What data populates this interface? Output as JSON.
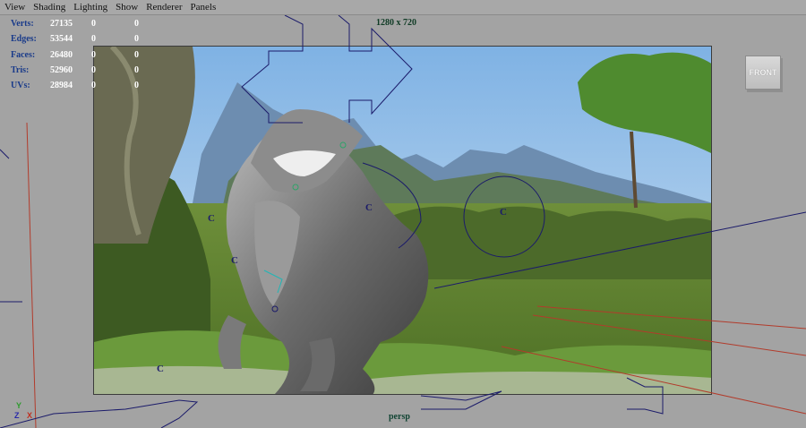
{
  "menu": {
    "items": [
      "View",
      "Shading",
      "Lighting",
      "Show",
      "Renderer",
      "Panels"
    ]
  },
  "hud": {
    "rows": [
      {
        "label": "Verts:",
        "v1": "27135",
        "v2": "0",
        "v3": "0"
      },
      {
        "label": "Edges:",
        "v1": "53544",
        "v2": "0",
        "v3": "0"
      },
      {
        "label": "Faces:",
        "v1": "26480",
        "v2": "0",
        "v3": "0"
      },
      {
        "label": "Tris:",
        "v1": "52960",
        "v2": "0",
        "v3": "0"
      },
      {
        "label": "UVs:",
        "v1": "28984",
        "v2": "0",
        "v3": "0"
      }
    ]
  },
  "resolution": "1280 x 720",
  "camera_name": "persp",
  "view_cube": {
    "label": "FRONT"
  },
  "axis": {
    "y": "Y",
    "z": "Z",
    "x": "X"
  },
  "controls": {
    "c": "C"
  },
  "colors": {
    "hud_label": "#1a3b8a",
    "background": "#a3a3a3",
    "gate": "#0f3b25"
  }
}
